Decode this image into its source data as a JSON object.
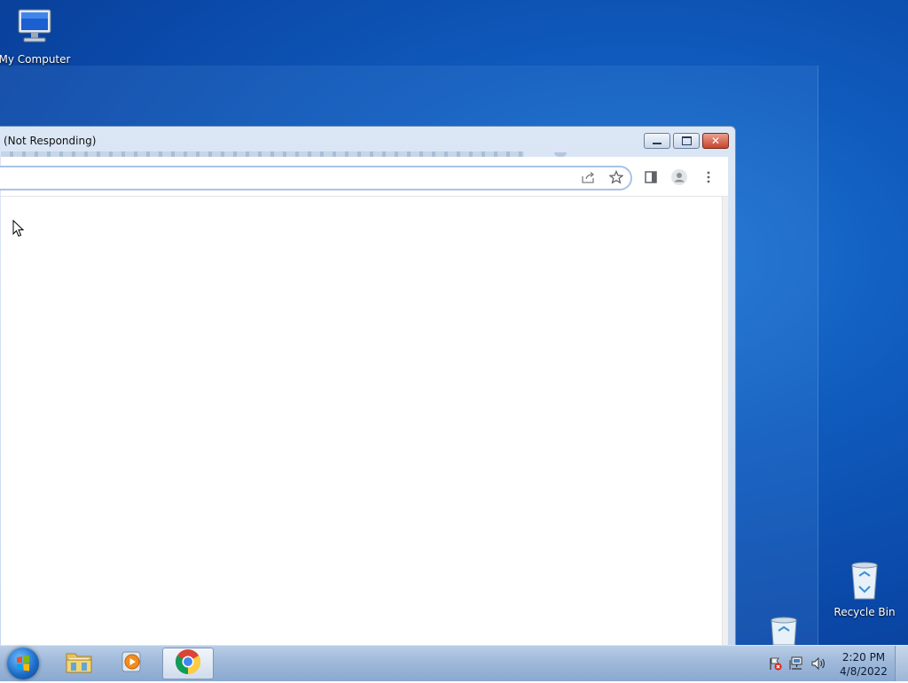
{
  "desktop": {
    "icons": [
      {
        "label": "My Computer",
        "icon": "computer-icon"
      },
      {
        "label": "Recycle Bin",
        "icon": "recycle-bin-icon"
      }
    ]
  },
  "window": {
    "title": "(Not Responding)",
    "controls": {
      "minimize": "minimize-icon",
      "maximize": "maximize-icon",
      "close": "close-icon"
    }
  },
  "toolbar": {
    "icons": [
      "share-icon",
      "star-icon",
      "side-panel-icon",
      "profile-icon",
      "more-vert-icon"
    ]
  },
  "taskbar": {
    "apps": [
      {
        "name": "file-explorer",
        "icon": "folder-icon"
      },
      {
        "name": "media-player",
        "icon": "media-player-icon"
      },
      {
        "name": "chrome",
        "icon": "chrome-icon",
        "active": true
      }
    ],
    "tray_icons": [
      "action-center-flag-icon",
      "network-icon",
      "volume-icon"
    ],
    "clock": {
      "time": "2:20 PM",
      "date": "4/8/2022"
    }
  },
  "colors": {
    "desktop": "#0f5bbd",
    "taskbar": "#9fb9da",
    "omnibox_border": "#a9c3e6",
    "close_button": "#c8452d"
  }
}
